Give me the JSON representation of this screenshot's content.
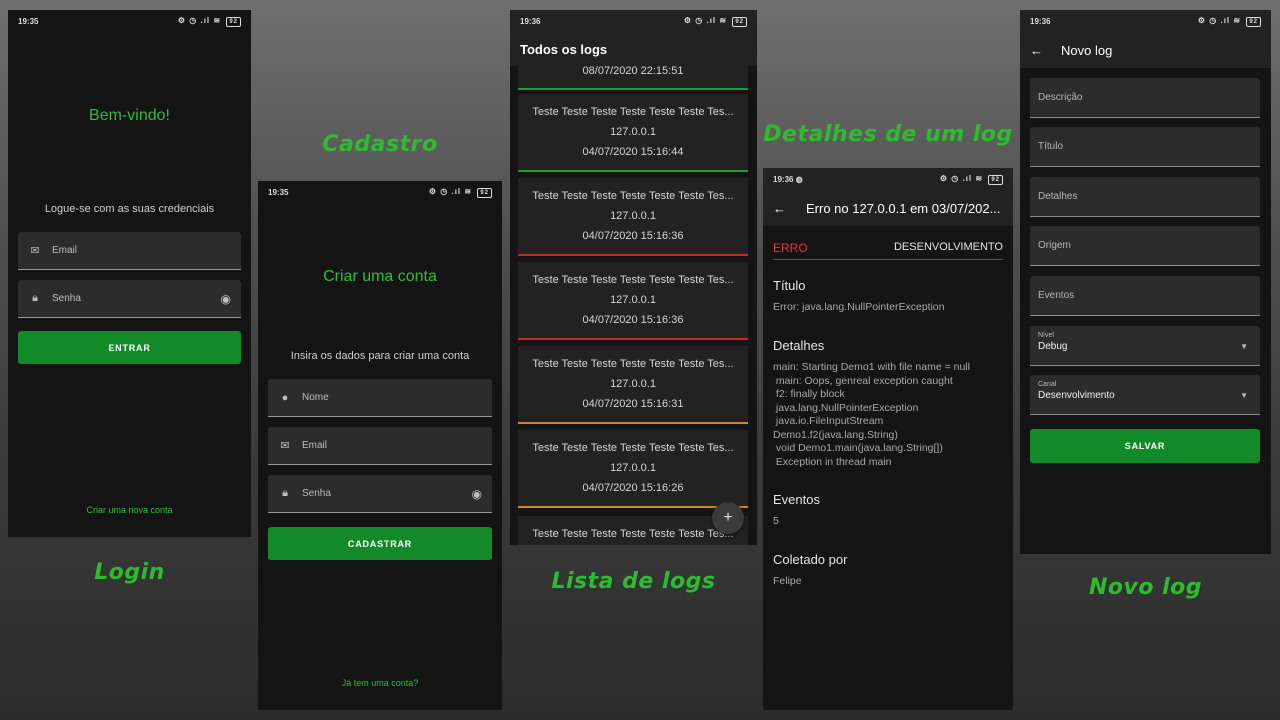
{
  "captions": {
    "login": "Login",
    "cadastro": "Cadastro",
    "lista": "Lista de logs",
    "detalhes": "Detalhes de um log",
    "novo": "Novo log"
  },
  "login": {
    "time": "19:35",
    "welcome": "Bem-vindo!",
    "instruction": "Logue-se com as suas credenciais",
    "email_placeholder": "Email",
    "senha_placeholder": "Senha",
    "entrar": "ENTRAR",
    "create_account": "Criar uma nova conta"
  },
  "cadastro": {
    "time": "19:35",
    "title": "Criar uma conta",
    "instruction": "Insira os dados para criar uma conta",
    "nome_placeholder": "Nome",
    "email_placeholder": "Email",
    "senha_placeholder": "Senha",
    "cadastrar": "CADASTRAR",
    "have_account": "Já tem uma conta?"
  },
  "lista": {
    "time": "19:36",
    "title": "Todos os logs",
    "partial_top_date": "08/07/2020  22:15:51",
    "cards": [
      {
        "text": "Teste Teste Teste Teste Teste Teste Tes...",
        "ip": "127.0.0.1",
        "date": "04/07/2020  15:16:44",
        "color": "#1e9e3a"
      },
      {
        "text": "Teste Teste Teste Teste Teste Teste Tes...",
        "ip": "127.0.0.1",
        "date": "04/07/2020  15:16:36",
        "color": "#c62828"
      },
      {
        "text": "Teste Teste Teste Teste Teste Teste Tes...",
        "ip": "127.0.0.1",
        "date": "04/07/2020  15:16:36",
        "color": "#c62828"
      },
      {
        "text": "Teste Teste Teste Teste Teste Teste Tes...",
        "ip": "127.0.0.1",
        "date": "04/07/2020  15:16:31",
        "color": "#d08a1a"
      },
      {
        "text": "Teste Teste Teste Teste Teste Teste Tes...",
        "ip": "127.0.0.1",
        "date": "04/07/2020  15:16:26",
        "color": "#d08a1a"
      }
    ],
    "partial_bottom_text": "Teste Teste Teste Teste Teste Teste Tes..."
  },
  "detalhes": {
    "time": "19:36",
    "title": "Erro no 127.0.0.1 em 03/07/202...",
    "level": "ERRO",
    "channel": "DESENVOLVIMENTO",
    "titulo_label": "Título",
    "titulo_value": "Error: java.lang.NullPointerException",
    "detalhes_label": "Detalhes",
    "detalhes_value": "main: Starting Demo1 with file name = null\n main: Oops, genreal exception caught\n f2: finally block\n java.lang.NullPointerException\n java.io.FileInputStream\nDemo1.f2(java.lang.String)\n void Demo1.main(java.lang.String[])\n Exception in thread main",
    "eventos_label": "Eventos",
    "eventos_value": "5",
    "coletado_label": "Coletado por",
    "coletado_value": "Felipe"
  },
  "novo": {
    "time": "19:36",
    "title": "Novo log",
    "fields": [
      "Descrição",
      "Título",
      "Detalhes",
      "Origem",
      "Eventos"
    ],
    "nivel_label": "Nível",
    "nivel_value": "Debug",
    "canal_label": "Canal",
    "canal_value": "Desenvolvimento",
    "salvar": "SALVAR"
  },
  "colors": {
    "accent_green": "#2bbd2b",
    "button_green": "#138a2a",
    "error_red": "#e53935"
  }
}
